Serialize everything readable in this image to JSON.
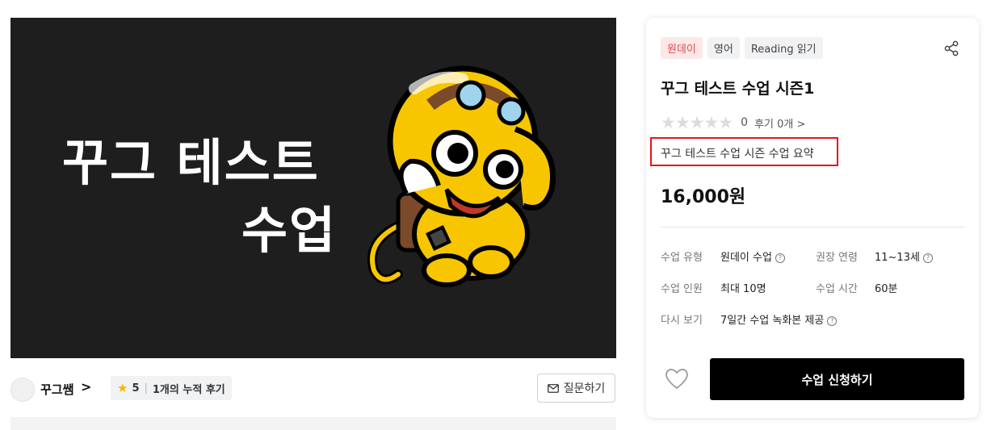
{
  "hero": {
    "title_line1": "꾸그 테스트",
    "title_line2": "수업"
  },
  "teacher": {
    "name": "꾸그쌤",
    "chevron": ">",
    "rating": "5",
    "review_text": "1개의 누적 후기",
    "ask_button": "질문하기"
  },
  "card": {
    "tags": [
      "원데이",
      "영어",
      "Reading 읽기"
    ],
    "title": "꾸그 테스트 수업 시즌1",
    "rating_count": "0",
    "review_link": "후기 0개 >",
    "summary": "꾸그 테스트 수업 시즌 수업 요약",
    "price": "16,000원",
    "info": {
      "type_label": "수업 유형",
      "type_value": "원데이 수업",
      "age_label": "권장 연령",
      "age_value": "11~13세",
      "size_label": "수업 인원",
      "size_value": "최대 10명",
      "time_label": "수업 시간",
      "time_value": "60분",
      "replay_label": "다시 보기",
      "replay_value": "7일간 수업 녹화본 제공"
    },
    "apply_button": "수업 신청하기"
  },
  "icons": [
    "share-icon",
    "heart-icon",
    "mail-icon",
    "star-icon",
    "help-circle-icon"
  ],
  "colors": {
    "hero_bg": "#1e1e1e",
    "mascot_yellow": "#f7c600",
    "tag_red_bg": "#fde7e7",
    "tag_red_text": "#e04b4b",
    "highlight_border": "#e8141b",
    "apply_bg": "#000000",
    "star_filled": "#f6b800",
    "star_empty": "#dcdcdc"
  }
}
